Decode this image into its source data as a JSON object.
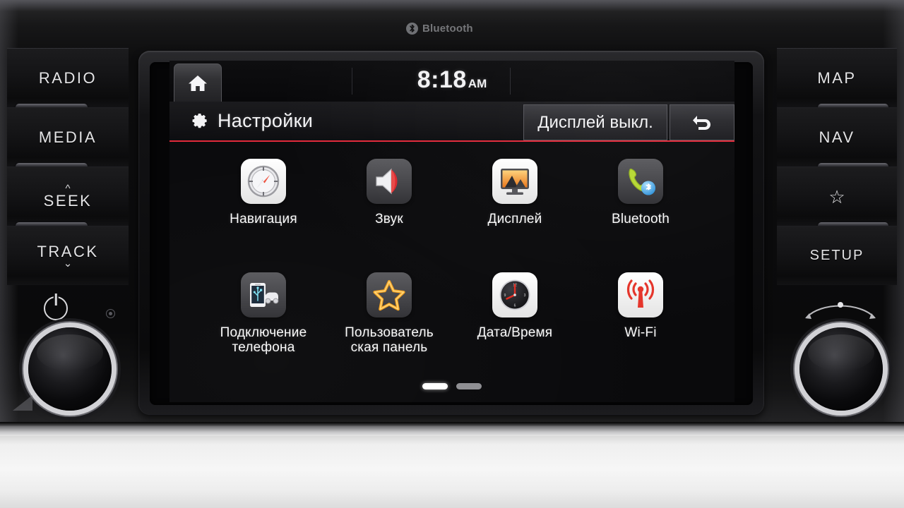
{
  "device": {
    "brand_badge": "Bluetooth",
    "badge_icon": "bluetooth-icon"
  },
  "hard_keys": {
    "left": [
      {
        "label": "RADIO",
        "name": "radio-button"
      },
      {
        "label": "MEDIA",
        "name": "media-button"
      },
      {
        "label": "SEEK",
        "name": "seek-button",
        "chevron": "up"
      },
      {
        "label": "TRACK",
        "name": "track-button",
        "chevron": "down"
      }
    ],
    "right": [
      {
        "label": "MAP",
        "name": "map-button"
      },
      {
        "label": "NAV",
        "name": "nav-button"
      },
      {
        "label": "",
        "name": "favorites-star-button",
        "glyph": "star"
      },
      {
        "label": "SETUP",
        "name": "setup-button"
      }
    ],
    "left_knob": {
      "name": "power-volume-knob",
      "icon": "power-icon"
    },
    "right_knob": {
      "name": "tune-knob",
      "icon": "tune-arc-icon"
    }
  },
  "screen": {
    "status_bar": {
      "home_icon": "home-icon",
      "time": "8:18",
      "meridiem": "AM"
    },
    "title_bar": {
      "icon": "gear-icon",
      "title": "Настройки",
      "display_off_label": "Дисплей выкл.",
      "back_icon": "back-arrow-icon",
      "accent_color": "#e2293a"
    },
    "apps": [
      {
        "label": "Навигация",
        "icon": "compass-icon",
        "style": "light",
        "name": "app-navigation"
      },
      {
        "label": "Звук",
        "icon": "speaker-icon",
        "style": "dark",
        "name": "app-sound"
      },
      {
        "label": "Дисплей",
        "icon": "monitor-photo-icon",
        "style": "light",
        "name": "app-display"
      },
      {
        "label": "Bluetooth",
        "icon": "phone-bluetooth-icon",
        "style": "dark",
        "name": "app-bluetooth"
      },
      {
        "label": "Подключение\nтелефона",
        "icon": "phone-usb-car-icon",
        "style": "dark",
        "name": "app-phone-projection"
      },
      {
        "label": "Пользователь\nская панель",
        "icon": "star-icon",
        "style": "dark",
        "name": "app-user-panel"
      },
      {
        "label": "Дата/Время",
        "icon": "clock-icon",
        "style": "light",
        "name": "app-date-time"
      },
      {
        "label": "Wi-Fi",
        "icon": "wifi-antenna-icon",
        "style": "light",
        "name": "app-wifi"
      }
    ],
    "pagination": {
      "total": 2,
      "active_index": 0
    }
  }
}
